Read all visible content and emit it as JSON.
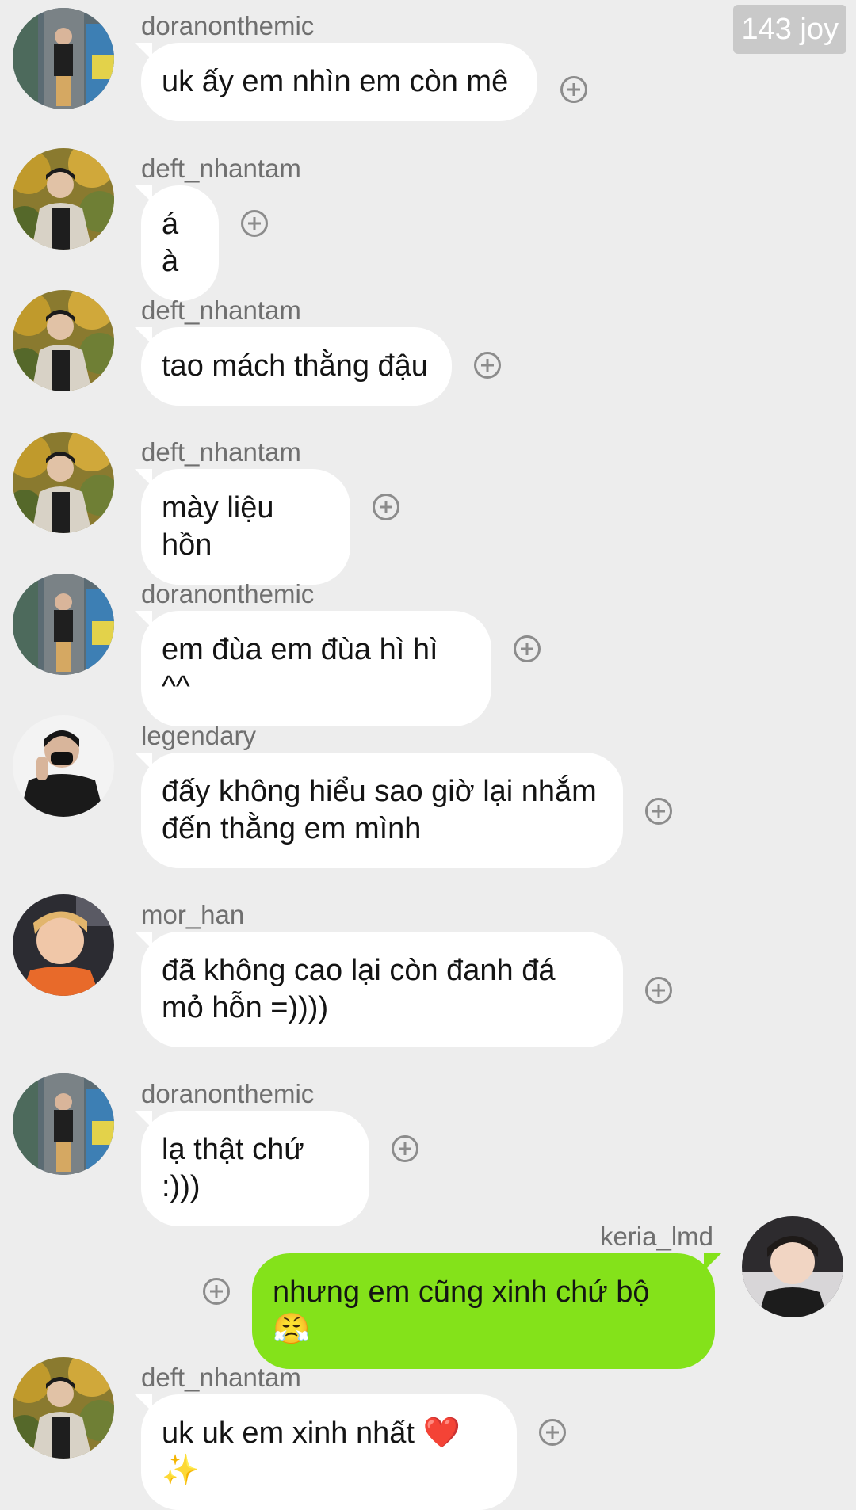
{
  "watermark": "143 joy",
  "messages": [
    {
      "sender": "doranonthemic",
      "text": "uk ấy em nhìn em còn mê",
      "avatar": "doran-avatar"
    },
    {
      "sender": "deft_nhantam",
      "text": "á à",
      "avatar": "deft-avatar"
    },
    {
      "sender": "deft_nhantam",
      "text": "tao mách thằng đậu",
      "avatar": "deft-avatar"
    },
    {
      "sender": "deft_nhantam",
      "text": "mày liệu hồn",
      "avatar": "deft-avatar"
    },
    {
      "sender": "doranonthemic",
      "text": "em đùa em đùa hì hì ^^",
      "avatar": "doran-avatar"
    },
    {
      "sender": "legendary",
      "text": "đấy không hiểu sao giờ lại nhắm\nđến thằng em mình",
      "avatar": "legendary-avatar"
    },
    {
      "sender": "mor_han",
      "text": "đã không cao lại còn đanh đá\nmỏ hỗn =))))",
      "avatar": "morhan-avatar"
    },
    {
      "sender": "doranonthemic",
      "text": "lạ thật chứ :)))",
      "avatar": "doran-avatar"
    },
    {
      "sender": "keria_lmd",
      "text": "nhưng em cũng xinh chứ bộ 😤",
      "avatar": "keria-avatar",
      "outgoing": true
    },
    {
      "sender": "deft_nhantam",
      "text": "uk uk em xinh nhất ❤️✨",
      "avatar": "deft-avatar"
    }
  ],
  "colors": {
    "background": "#ededed",
    "incoming_bubble": "#ffffff",
    "outgoing_bubble": "#84e21a",
    "sender_text": "#6f6f6f"
  },
  "icons": {
    "react": "add-reaction-icon"
  }
}
